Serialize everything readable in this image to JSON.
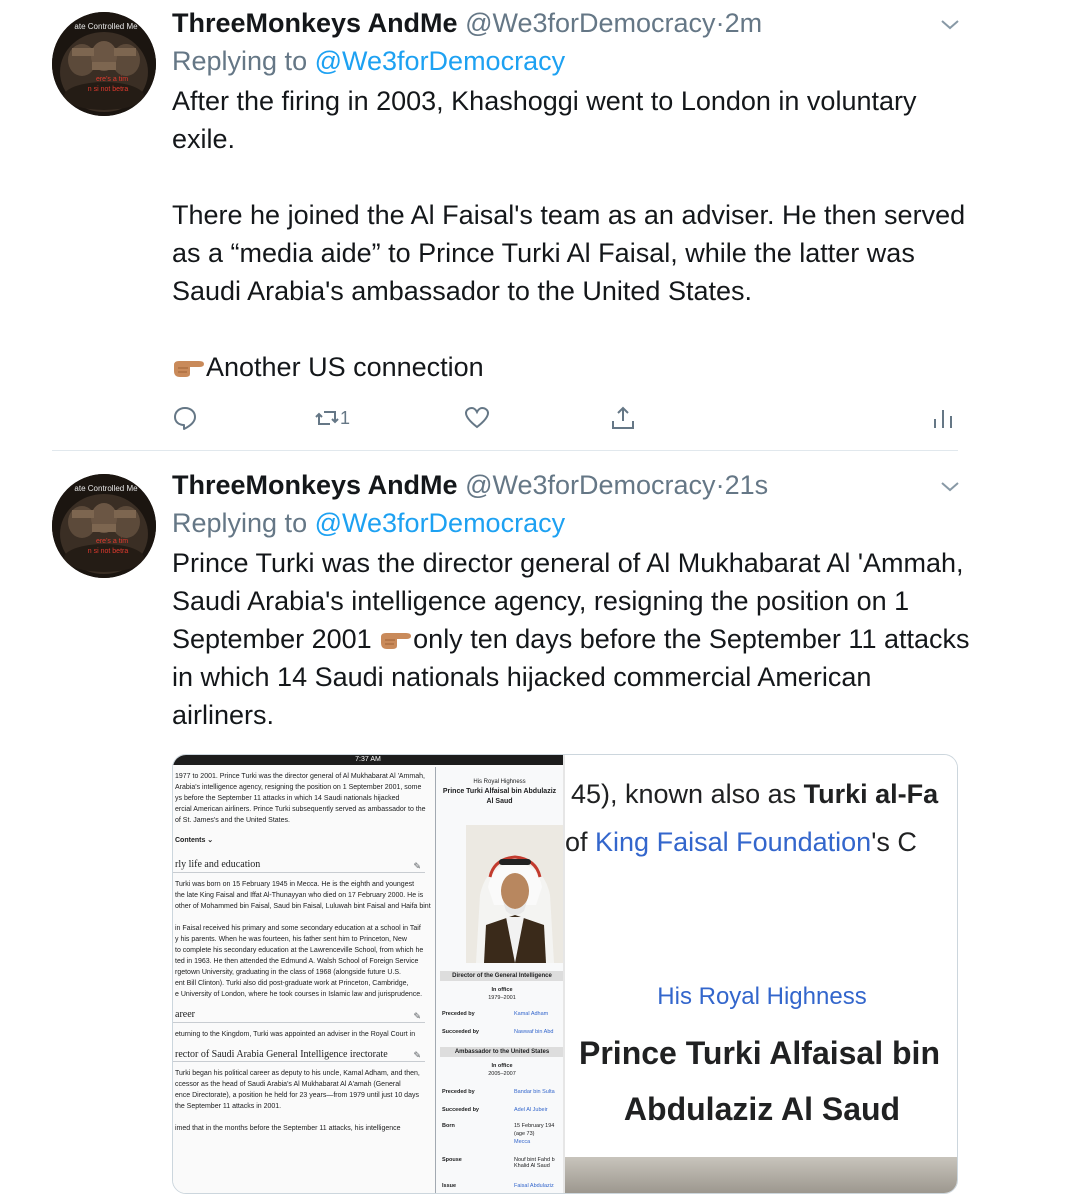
{
  "tweets": [
    {
      "display_name": "ThreeMonkeys AndMe",
      "handle": "@We3forDemocracy",
      "time": "2m",
      "replying_label": "Replying to",
      "replying_handle": "@We3forDemocracy",
      "paragraphs": [
        "After the firing in 2003, Khashoggi went to London in voluntary exile.",
        "There he joined the Al Faisal's team as an adviser. He then served as a “media aide” to Prince Turki Al Faisal, while the latter was Saudi Arabia's ambassador to the United States.",
        "Another US connection"
      ],
      "retweet_count": "1"
    },
    {
      "display_name": "ThreeMonkeys AndMe",
      "handle": "@We3forDemocracy",
      "time": "21s",
      "replying_label": "Replying to",
      "replying_handle": "@We3forDemocracy",
      "text_before_emoji": "Prince Turki was the director general of Al Mukhabarat Al 'Ammah, Saudi Arabia's intelligence agency, resigning the position on 1 September 2001",
      "text_after_emoji": "only ten days before the September 11 attacks in which 14 Saudi nationals hijacked commercial American airliners."
    }
  ],
  "avatar_text": {
    "top": "ate Controlled Me",
    "middle": "ere's a tim",
    "bottom": "n si not betra"
  },
  "screenshot_left": {
    "status_time": "7:37 AM",
    "intro_lines": [
      "1977 to 2001. Prince Turki was the director general of Al Mukhabarat Al 'Ammah,",
      "Arabia's intelligence agency, resigning the position on 1 September 2001, some",
      "ys before the September 11 attacks in which 14 Saudi nationals hijacked",
      "ercial American airliners. Prince Turki subsequently served as ambassador to the",
      "of St. James's and the United States."
    ],
    "contents_label": "Contents",
    "sections": [
      {
        "heading": "rly life and education",
        "lines": [
          "Turki was born on 15 February 1945 in Mecca. He is the eighth and youngest",
          "the late King Faisal and Iffat Al-Thunayyan who died on 17 February 2000. He is",
          "other of Mohammed bin Faisal, Saud bin Faisal, Luluwah bint Faisal and Haifa bint",
          "",
          "in Faisal received his primary and some secondary education at a school in Taif",
          "y his parents. When he was fourteen, his father sent him to Princeton, New",
          "to complete his secondary education at the Lawrenceville School, from which he",
          "ted in 1963. He then attended the Edmund A. Walsh School of Foreign Service",
          "rgetown University, graduating in the class of 1968 (alongside future U.S.",
          "ent Bill Clinton). Turki also did post-graduate work at Princeton, Cambridge,",
          "e University of London, where he took courses in Islamic law and jurisprudence."
        ]
      },
      {
        "heading": "areer",
        "lines": [
          "eturning to the Kingdom, Turki was appointed an adviser in the Royal Court in"
        ]
      },
      {
        "heading": "rector of Saudi Arabia General Intelligence irectorate",
        "lines": [
          "Turki began his political career as deputy to his uncle, Kamal Adham, and then,",
          "ccessor as the head of Saudi Arabia's Al Mukhabarat Al A'amah (General",
          "ence Directorate), a position he held for 23 years—from 1979 until just 10 days",
          "the September 11 attacks in 2001.",
          "",
          "imed that in the months before the September 11 attacks, his intelligence"
        ]
      }
    ],
    "infobox": {
      "honorific": "His Royal Highness",
      "name": "Prince Turki Alfaisal bin Abdulaziz Al Saud",
      "section1": "Director of the General Intelligence",
      "in_office_label": "In office",
      "term1": "1979–2001",
      "preceded_by_label": "Preceded by",
      "preceded1": "Kamal Adham",
      "succeeded_by_label": "Succeeded by",
      "succeeded1": "Nawwaf bin Abd",
      "section2": "Ambassador to the United States",
      "term2": "2005–2007",
      "preceded2": "Bandar bin Sulta",
      "succeeded2": "Adel Al Jubeir",
      "born_label": "Born",
      "born_value": "15 February 194",
      "born_age": "(age 73)",
      "born_place": "Mecca",
      "spouse_label": "Spouse",
      "spouse_value": "Nouf bint Fahd b Khalid Al Saud",
      "issue_label": "Issue",
      "issue_value": "Faisal Abdulaziz"
    }
  },
  "screenshot_right": {
    "line1_plain": "45), known also as ",
    "line1_bold": "Turki al-Fa",
    "line2_plain_before": "of ",
    "line2_link": "King Faisal Foundation",
    "line2_plain_after": "'s C",
    "honorific": "His Royal Highness",
    "name_line1": "Prince Turki Alfaisal bin",
    "name_line2": "Abdulaziz Al Saud"
  }
}
